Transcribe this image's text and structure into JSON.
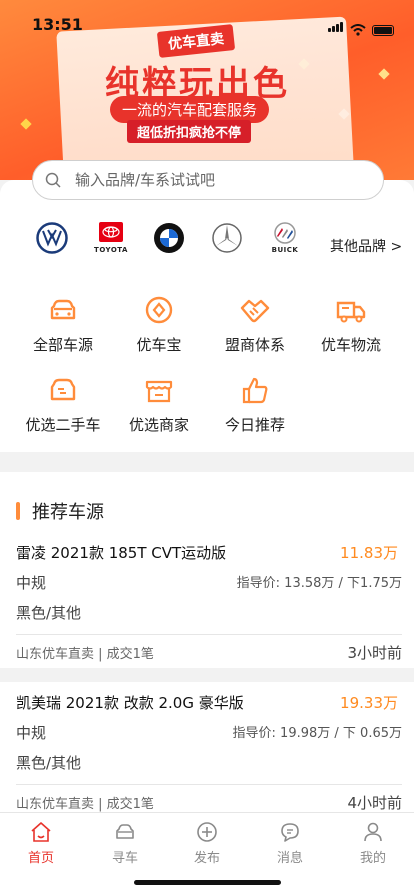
{
  "status_bar": {
    "time": "13:51"
  },
  "banner": {
    "tag": "优车直卖",
    "headline": "纯粹玩出色",
    "subline": "一流的汽车配套服务",
    "promo": "超低折扣疯抢不停"
  },
  "search": {
    "placeholder": "输入品牌/车系试试吧"
  },
  "brands": [
    {
      "name": "Volkswagen",
      "icon": "vw-logo-icon",
      "caption": ""
    },
    {
      "name": "Toyota",
      "icon": "toyota-logo-icon",
      "caption": "TOYOTA"
    },
    {
      "name": "BMW",
      "icon": "bmw-logo-icon",
      "caption": ""
    },
    {
      "name": "Mercedes-Benz",
      "icon": "mercedes-logo-icon",
      "caption": ""
    },
    {
      "name": "Buick",
      "icon": "buick-logo-icon",
      "caption": "BUICK"
    }
  ],
  "brands_more": "其他品牌 >",
  "quick_menu": [
    {
      "label": "全部车源",
      "icon": "car-icon"
    },
    {
      "label": "优车宝",
      "icon": "coin-icon"
    },
    {
      "label": "盟商体系",
      "icon": "handshake-icon"
    },
    {
      "label": "优车物流",
      "icon": "truck-icon"
    },
    {
      "label": "优选二手车",
      "icon": "used-car-icon"
    },
    {
      "label": "优选商家",
      "icon": "shop-icon"
    },
    {
      "label": "今日推荐",
      "icon": "thumbs-up-icon"
    }
  ],
  "section_title": "推荐车源",
  "listings": [
    {
      "title": "雷凌 2021款 185T CVT运动版",
      "price": "11.83万",
      "spec": "中规",
      "guide": "指导价: 13.58万 / 下1.75万",
      "color": "黑色/其他",
      "seller": "山东优车直卖 | 成交1笔",
      "ago": "3小时前"
    },
    {
      "title": "凯美瑞 2021款 改款 2.0G 豪华版",
      "price": "19.33万",
      "spec": "中规",
      "guide": "指导价: 19.98万 / 下 0.65万",
      "color": "黑色/其他",
      "seller": "山东优车直卖 | 成交1笔",
      "ago": "4小时前"
    }
  ],
  "tabbar": [
    {
      "label": "首页",
      "icon": "home-icon",
      "active": true
    },
    {
      "label": "寻车",
      "icon": "car-search-icon",
      "active": false
    },
    {
      "label": "发布",
      "icon": "plus-circle-icon",
      "active": false
    },
    {
      "label": "消息",
      "icon": "chat-icon",
      "active": false
    },
    {
      "label": "我的",
      "icon": "profile-icon",
      "active": false
    }
  ],
  "colors": {
    "accent": "#ff8c3b",
    "price": "#ff8a1f",
    "active_tab": "#e8332b"
  }
}
